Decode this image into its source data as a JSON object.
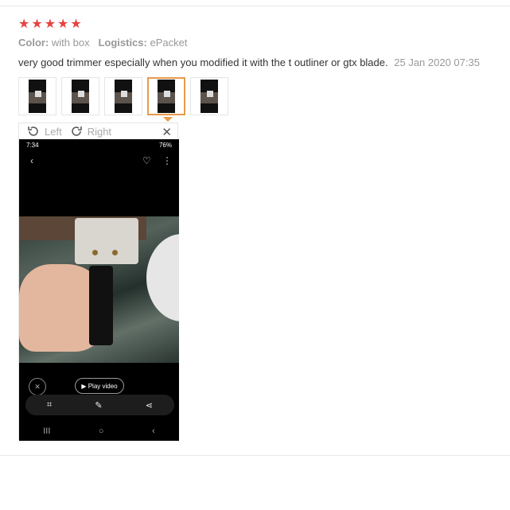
{
  "rating": {
    "stars": 5,
    "star_glyph": "★",
    "color": "#e64340"
  },
  "meta": {
    "color_label": "Color:",
    "color_value": "with box",
    "logistics_label": "Logistics:",
    "logistics_value": "ePacket"
  },
  "review": {
    "text": "very good trimmer especially when you modified it with the t outliner or gtx blade.",
    "date": "25 Jan 2020 07:35"
  },
  "thumbnails": {
    "count": 5,
    "active_index": 3,
    "active_color": "#e89a4a"
  },
  "viewer": {
    "left_label": "Left",
    "right_label": "Right",
    "close_glyph": "✕",
    "phone": {
      "time": "7:34",
      "status_right": "76%",
      "play_label": "▶ Play video",
      "nav_recent": "III",
      "nav_home": "○",
      "nav_back": "‹"
    }
  }
}
